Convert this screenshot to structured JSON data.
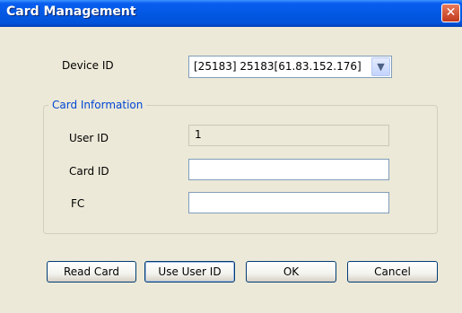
{
  "window": {
    "title": "Card Management",
    "close_glyph": "✕"
  },
  "device": {
    "label": "Device ID",
    "selected": "[25183] 25183[61.83.152.176]"
  },
  "card_info": {
    "legend": "Card Information",
    "user_id_label": "User ID",
    "user_id_value": "1",
    "card_id_label": "Card ID",
    "card_id_value": "",
    "fc_label": "FC",
    "fc_value": ""
  },
  "buttons": {
    "read_card": "Read Card",
    "use_user_id": "Use User ID",
    "ok": "OK",
    "cancel": "Cancel"
  },
  "icons": {
    "close": "close-icon",
    "dropdown": "chevron-down-icon"
  },
  "colors": {
    "titlebar": "#0358e3",
    "group_label": "#0046d5",
    "dialog_bg": "#ece9d8"
  }
}
